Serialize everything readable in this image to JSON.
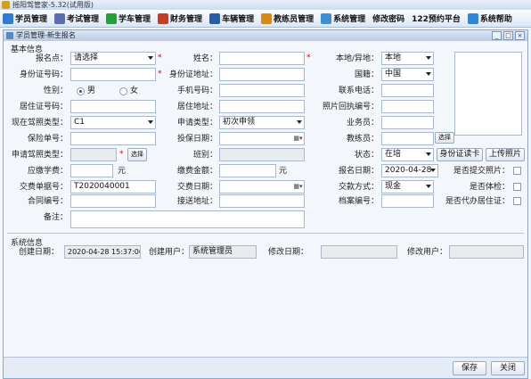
{
  "app": {
    "title": "摇阳驾管家-5.32(试用版)"
  },
  "menubar": {
    "items": [
      {
        "label": "学员管理",
        "icon": "student-icon",
        "color": "#2f7bd6"
      },
      {
        "label": "考试管理",
        "icon": "exam-icon",
        "color": "#5a6db0"
      },
      {
        "label": "学车管理",
        "icon": "car-learn-icon",
        "color": "#2a9c3a"
      },
      {
        "label": "财务管理",
        "icon": "finance-icon",
        "color": "#c23c2a"
      },
      {
        "label": "车辆管理",
        "icon": "vehicle-icon",
        "color": "#2b5aa6"
      },
      {
        "label": "教练员管理",
        "icon": "coach-icon",
        "color": "#d48a16"
      },
      {
        "label": "系统管理",
        "icon": "system-icon",
        "color": "#3f8fd2"
      },
      {
        "label": "修改密码",
        "icon": "",
        "color": ""
      },
      {
        "label": "122预约平台",
        "icon": "",
        "color": ""
      },
      {
        "label": "系统帮助",
        "icon": "help-icon",
        "color": "#2e86d9"
      }
    ]
  },
  "window": {
    "title": "学员管理-新生报名",
    "min": "_",
    "max": "□",
    "close": "×"
  },
  "basic": {
    "section": "基本信息"
  },
  "form": {
    "baomingdian": {
      "label": "报名点：",
      "value": "请选择"
    },
    "xingming": {
      "label": "姓名：",
      "value": ""
    },
    "bendi": {
      "label": "本地/异地：",
      "value": "本地"
    },
    "sfz": {
      "label": "身份证号码：",
      "value": ""
    },
    "sfzdizhi": {
      "label": "身份证地址：",
      "value": ""
    },
    "guoji": {
      "label": "国籍：",
      "value": "中国"
    },
    "xingbie": {
      "label": "性别：",
      "male": "男",
      "female": "女"
    },
    "shouji": {
      "label": "手机号码：",
      "value": ""
    },
    "lianxi": {
      "label": "联系电话：",
      "value": ""
    },
    "juzhuzheng": {
      "label": "居住证号码：",
      "value": ""
    },
    "juzhudizhi": {
      "label": "居住地址：",
      "value": ""
    },
    "zhaopian": {
      "label": "照片回执编号：",
      "value": ""
    },
    "xianzaijz": {
      "label": "现在驾照类型：",
      "value": "C1"
    },
    "shenqingleixing": {
      "label": "申请类型：",
      "value": "初次申领"
    },
    "yewuyuan": {
      "label": "业务员：",
      "value": ""
    },
    "baoxian": {
      "label": "保险单号：",
      "value": ""
    },
    "toubao": {
      "label": "投保日期：",
      "value": ""
    },
    "jiaolian": {
      "label": "教练员：",
      "value": ""
    },
    "jiaolian_btn": "选择",
    "shenqingjz": {
      "label": "申请驾照类型：",
      "value": ""
    },
    "shenqingjz_btn": "选择",
    "banbie": {
      "label": "班别：",
      "value": ""
    },
    "zhuangtai": {
      "label": "状态：",
      "value": "在培"
    },
    "btn_sfz": "身份证读卡",
    "btn_photo": "上传照片",
    "yingjiao": {
      "label": "应缴学费：",
      "value": "",
      "unit": "元"
    },
    "jiaofei": {
      "label": "缴费金额：",
      "value": "",
      "unit": "元"
    },
    "baomingriqi": {
      "label": "报名日期：",
      "value": "2020-04-28"
    },
    "tijiaozhao": {
      "label": "是否提交照片："
    },
    "danju": {
      "label": "交费单据号：",
      "value": "T2020040001"
    },
    "jiaofeiriqi": {
      "label": "交费日期：",
      "value": ""
    },
    "jiaokuan": {
      "label": "交款方式：",
      "value": "现金"
    },
    "tijian": {
      "label": "是否体检："
    },
    "hetong": {
      "label": "合同编号：",
      "value": ""
    },
    "jiesong": {
      "label": "接送地址：",
      "value": ""
    },
    "dangan": {
      "label": "档案编号：",
      "value": ""
    },
    "daiban": {
      "label": "是否代办居住证："
    },
    "beizhu": {
      "label": "备注：",
      "value": ""
    }
  },
  "sysinfo": {
    "section": "系统信息",
    "created_label": "创建日期：",
    "created_value": "2020-04-28 15:37:06",
    "user_label": "创建用户：",
    "user_value": "系统管理员",
    "modified_label": "修改日期：",
    "modified_value": "",
    "muser_label": "修改用户：",
    "muser_value": ""
  },
  "footer": {
    "save": "保存",
    "close": "关闭"
  }
}
